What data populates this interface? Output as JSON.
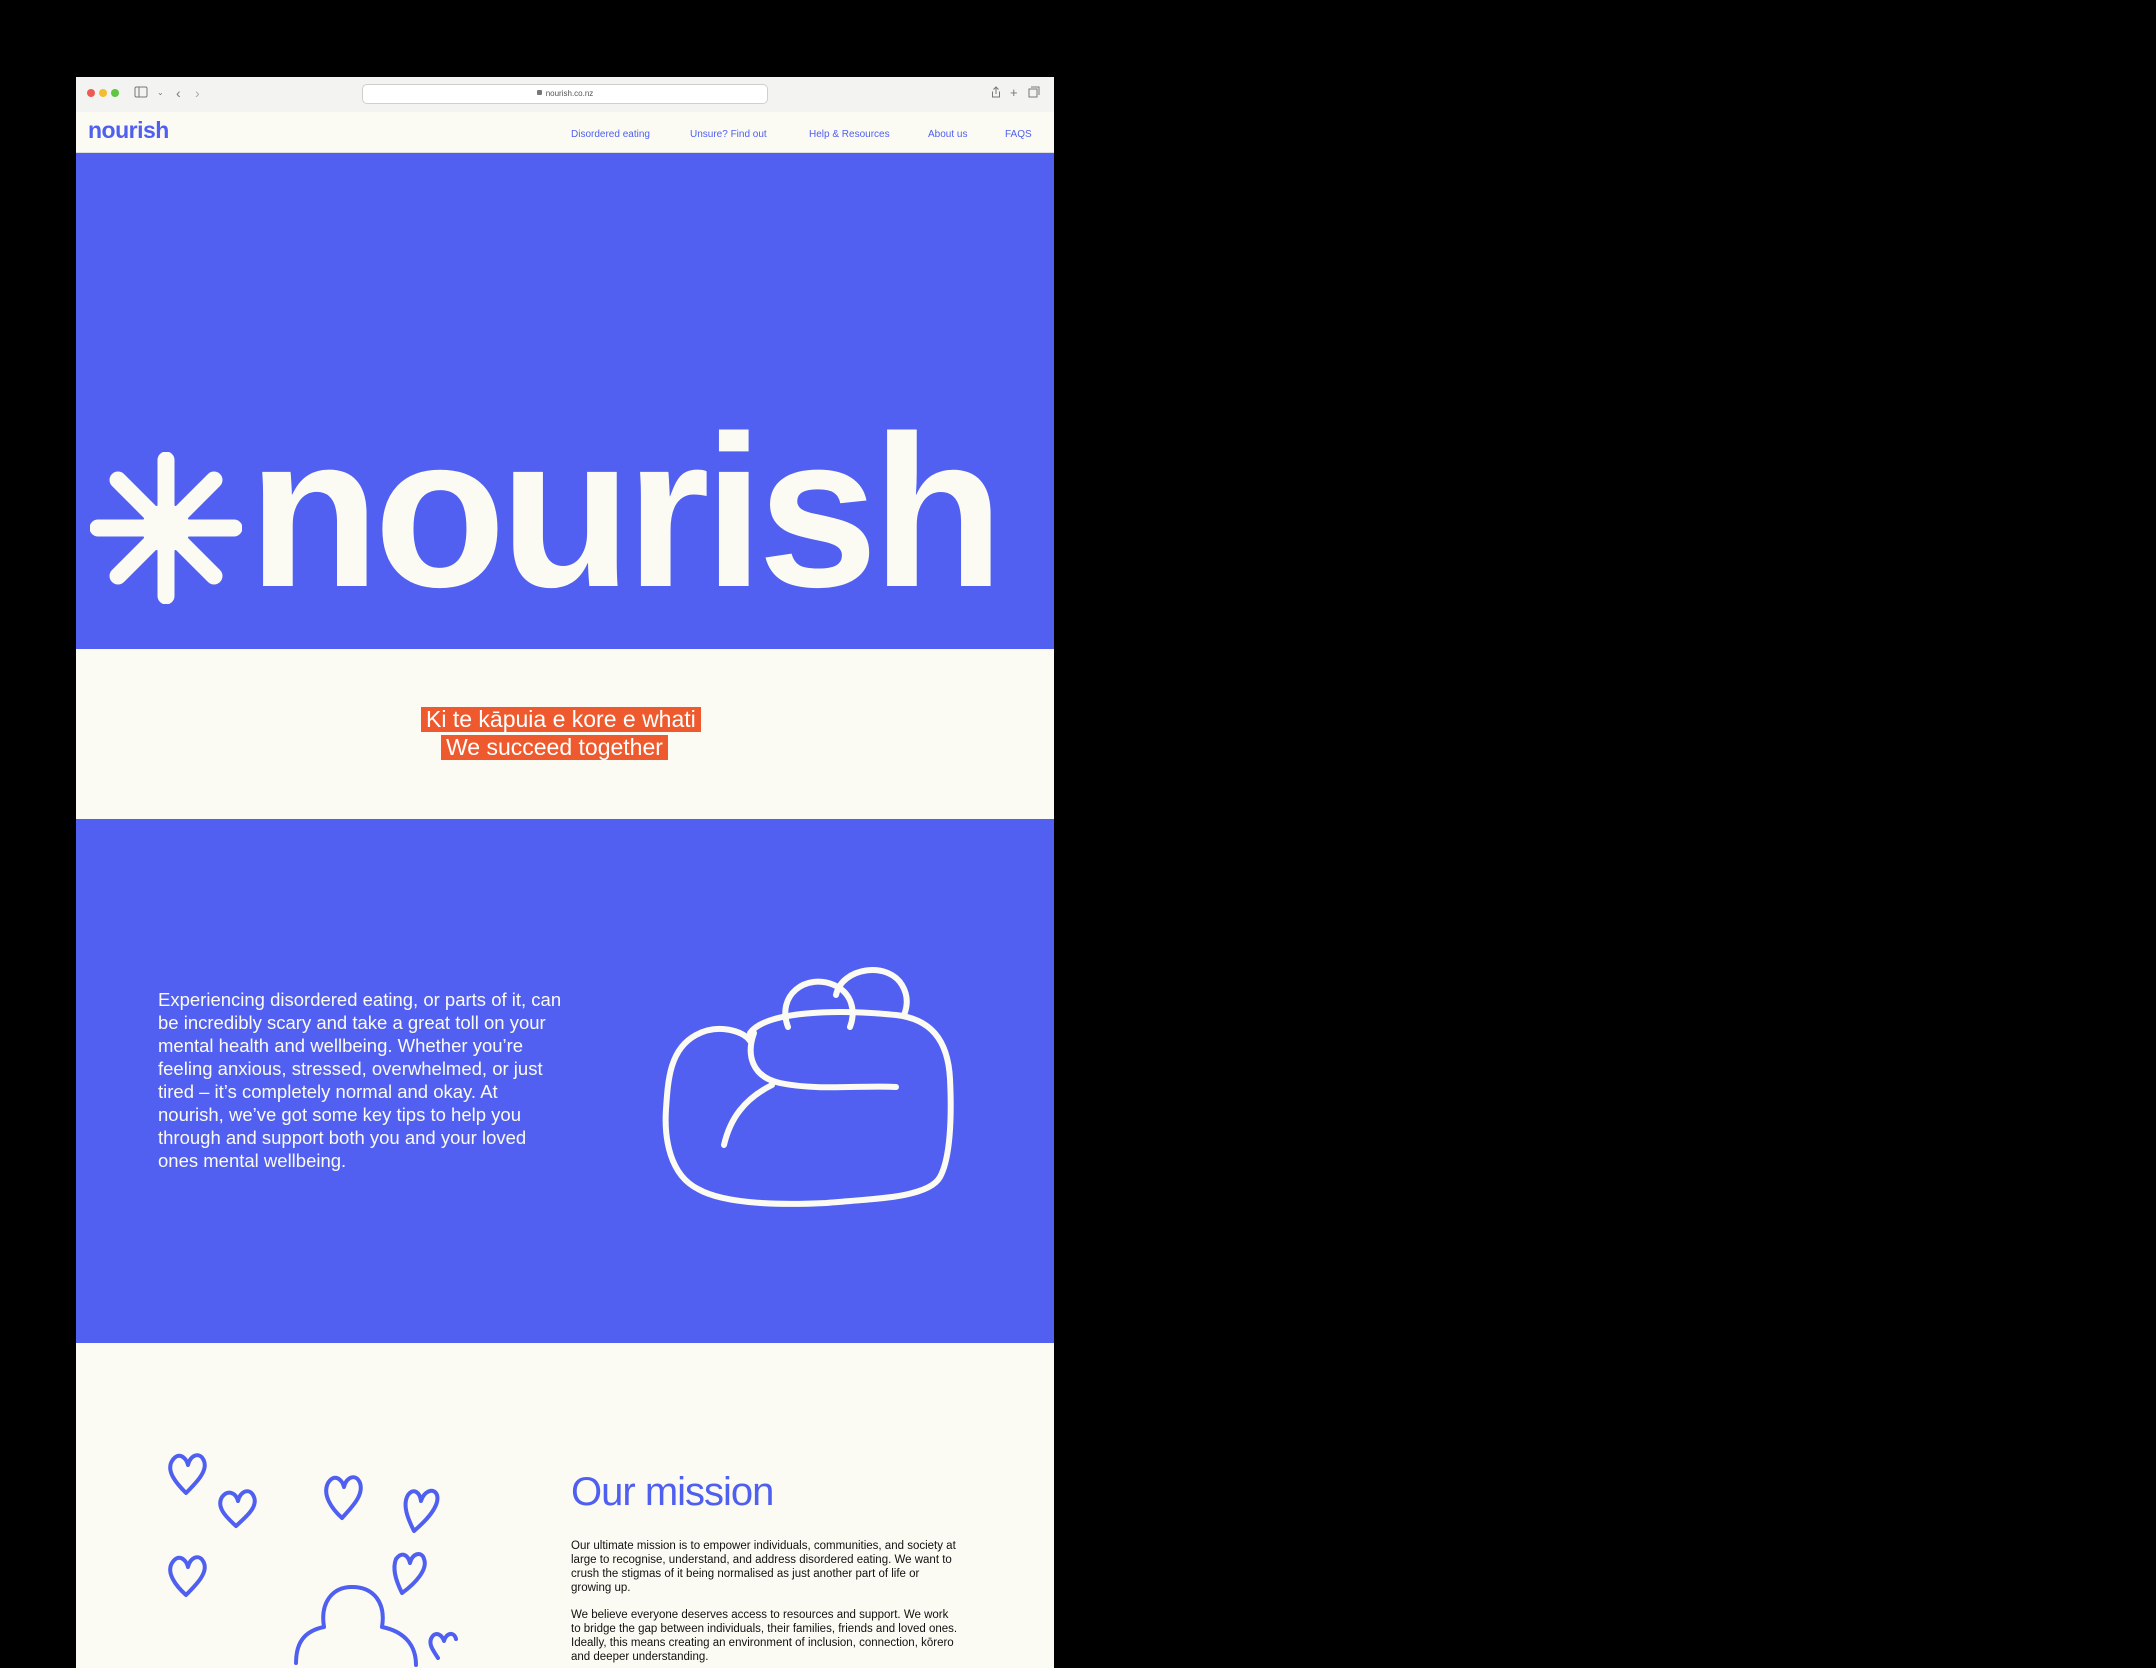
{
  "browser": {
    "url": "nourish.co.nz"
  },
  "site": {
    "logo": "nourish",
    "nav": [
      "Disordered eating",
      "Unsure? Find out",
      "Help & Resources",
      "About us",
      "FAQS"
    ]
  },
  "hero": {
    "wordmark": "nourish"
  },
  "tagline": {
    "maori": "Ki te kāpuia e kore e whati",
    "english": "We succeed together"
  },
  "intro": {
    "text": "Experiencing disordered eating, or parts of it, can be incredibly scary and take a great toll on your mental health and wellbeing. Whether you’re feeling anxious, stressed, overwhelmed, or just tired – it’s completely normal and okay. At nourish, we’ve got some key tips to help you through and support both you and your loved ones mental wellbeing."
  },
  "mission": {
    "title_light": "Our",
    "title_bold": "mission",
    "p1": "Our ultimate mission is to empower individuals, communities, and society at large to recognise, understand, and address disordered eating. We want to crush the stigmas of it being normalised as just another part of life or growing up.",
    "p2": "We believe everyone deserves access to resources and support. We work to bridge the gap between individuals, their families, friends and loved ones. Ideally, this means creating an environment of inclusion, connection, kōrero and deeper understanding."
  },
  "colors": {
    "brand_blue": "#5160f0",
    "cream": "#fbfbf3",
    "accent_orange": "#ee5a2d"
  }
}
